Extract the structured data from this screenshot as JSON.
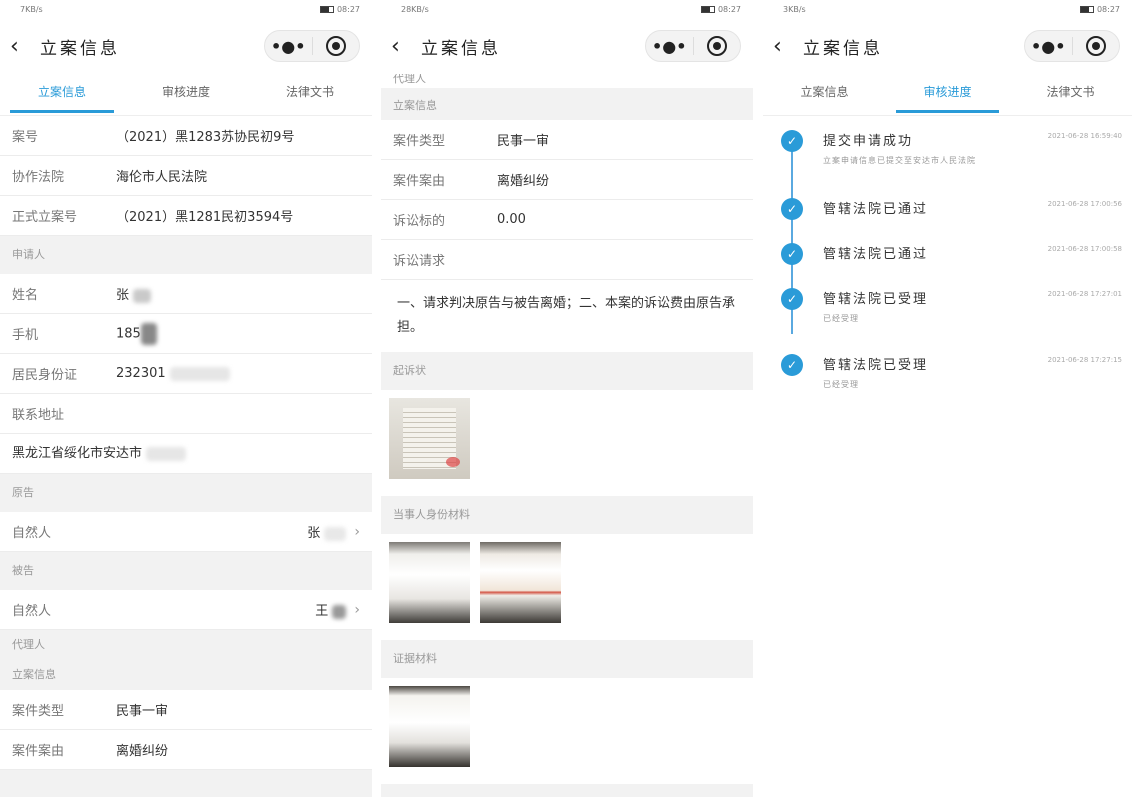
{
  "status_bar": {
    "p1_speed": "7KB/s",
    "p2_speed": "28KB/s",
    "p3_speed": "3KB/s",
    "time": "08:27"
  },
  "header": {
    "title": "立案信息",
    "back_icon": "chevron-left-icon",
    "more_icon": "more-dots-icon",
    "close_icon": "target-close-icon"
  },
  "tabs": [
    "立案信息",
    "审核进度",
    "法律文书"
  ],
  "screen1": {
    "rows": [
      {
        "label": "案号",
        "value": "（2021）黑1283苏协民初9号"
      },
      {
        "label": "协作法院",
        "value": "海伦市人民法院"
      },
      {
        "label": "正式立案号",
        "value": "（2021）黑1281民初3594号"
      }
    ],
    "applicant_section": "申请人",
    "applicant_rows": [
      {
        "label": "姓名",
        "value": "张"
      },
      {
        "label": "手机",
        "value": "185"
      },
      {
        "label": "居民身份证",
        "value": "232301"
      },
      {
        "label": "联系地址",
        "value": ""
      }
    ],
    "address": "黑龙江省绥化市安达市",
    "plaintiff_section": "原告",
    "plaintiff_row": {
      "label": "自然人",
      "value": "张"
    },
    "defendant_section": "被告",
    "defendant_row": {
      "label": "自然人",
      "value": "王"
    },
    "agent_section": "代理人",
    "case_info_section": "立案信息",
    "case_rows": [
      {
        "label": "案件类型",
        "value": "民事一审"
      },
      {
        "label": "案件案由",
        "value": "离婚纠纷"
      }
    ]
  },
  "screen2": {
    "agent_section": "代理人",
    "case_info_section": "立案信息",
    "rows": [
      {
        "label": "案件类型",
        "value": "民事一审"
      },
      {
        "label": "案件案由",
        "value": "离婚纠纷"
      },
      {
        "label": "诉讼标的",
        "value": "0.00"
      },
      {
        "label": "诉讼请求",
        "value": ""
      }
    ],
    "claim_text": "一、请求判决原告与被告离婚；二、本案的诉讼费由原告承担。",
    "complaint_section": "起诉状",
    "id_section": "当事人身份材料",
    "evidence_section": "证据材料"
  },
  "screen3": {
    "steps": [
      {
        "title": "提交申请成功",
        "time": "2021-06-28 16:59:40",
        "sub": "立案申请信息已提交至安达市人民法院"
      },
      {
        "title": "管辖法院已通过",
        "time": "2021-06-28 17:00:56",
        "sub": ""
      },
      {
        "title": "管辖法院已通过",
        "time": "2021-06-28 17:00:58",
        "sub": ""
      },
      {
        "title": "管辖法院已受理",
        "time": "2021-06-28 17:27:01",
        "sub": "已经受理"
      },
      {
        "title": "管辖法院已受理",
        "time": "2021-06-28 17:27:15",
        "sub": "已经受理"
      }
    ]
  },
  "colors": {
    "accent": "#2a9bd8",
    "background": "#f2f2f2"
  }
}
